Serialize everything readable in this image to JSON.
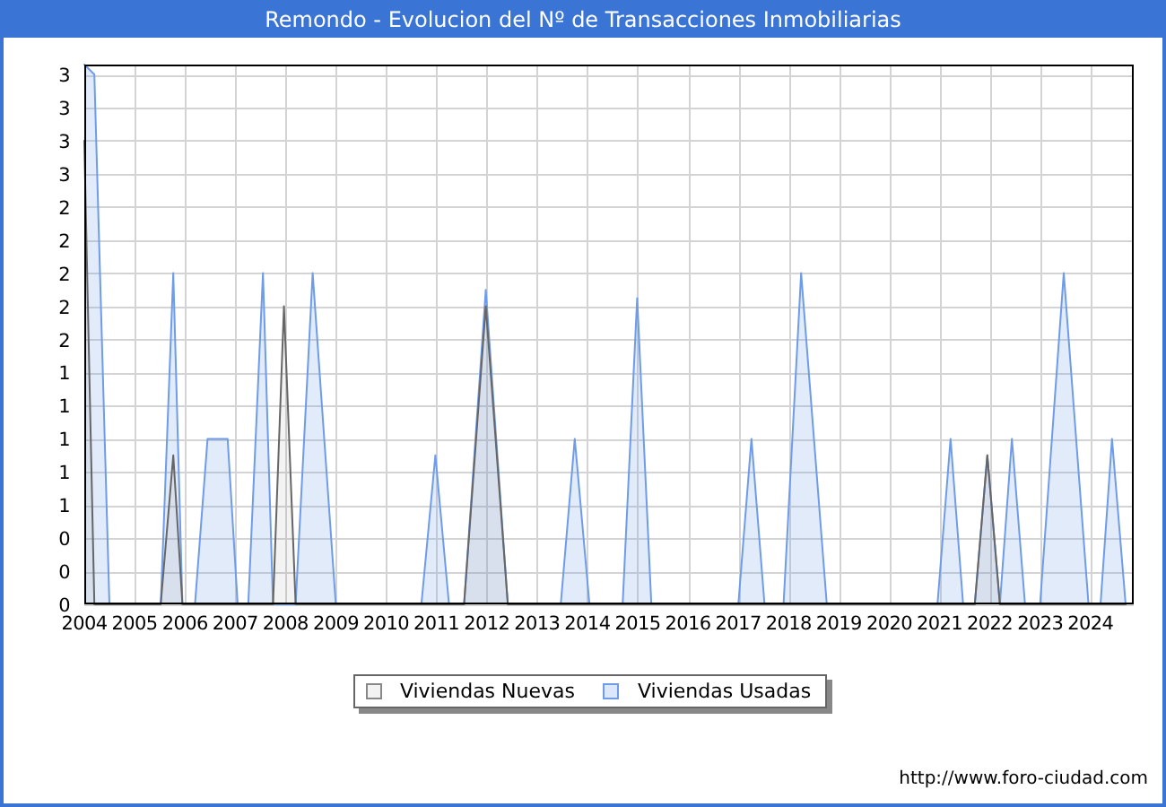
{
  "chart_data": {
    "type": "area",
    "title": "Remondo - Evolucion del Nº de Transacciones Inmobiliarias",
    "xlim": [
      2004,
      2024.86
    ],
    "ylim": [
      0,
      3.26
    ],
    "grid": true,
    "x": [
      2004,
      2004.2,
      2004.5,
      2005.52,
      2005.77,
      2005.95,
      2006.2,
      2006.45,
      2006.85,
      2007.05,
      2007.26,
      2007.55,
      2007.75,
      2007.97,
      2008.2,
      2008.54,
      2009.0,
      2010.7,
      2010.98,
      2011.25,
      2011.55,
      2011.98,
      2012.42,
      2013.47,
      2013.75,
      2014.04,
      2014.7,
      2014.99,
      2015.27,
      2017.0,
      2017.26,
      2017.52,
      2017.9,
      2018.25,
      2018.76,
      2020.96,
      2021.22,
      2021.47,
      2021.7,
      2021.95,
      2022.2,
      2022.44,
      2022.7,
      2023.0,
      2023.47,
      2023.96,
      2024.2,
      2024.43,
      2024.7
    ],
    "series": [
      {
        "name": "Viviendas Nuevas",
        "color": "#666666",
        "values": [
          2.8,
          0,
          0,
          0,
          0.9,
          0,
          0,
          0,
          0,
          0,
          0,
          0,
          0,
          1.8,
          0,
          0,
          0,
          0,
          0,
          0,
          0,
          1.8,
          0,
          0,
          0,
          0,
          0,
          0,
          0,
          0,
          0,
          0,
          0,
          0,
          0,
          0,
          0,
          0,
          0,
          0.9,
          0,
          0,
          0,
          0,
          0,
          0,
          0,
          0,
          0
        ]
      },
      {
        "name": "Viviendas Usadas",
        "color": "#6f9ce8",
        "values": [
          3.26,
          3.2,
          0,
          0,
          2,
          0,
          0,
          1,
          1,
          0,
          0,
          2,
          0,
          0,
          0,
          2,
          0,
          0,
          0.9,
          0,
          0,
          1.9,
          0,
          0,
          1,
          0,
          0,
          1.85,
          0,
          0,
          1,
          0,
          0,
          2,
          0,
          0,
          1,
          0,
          0,
          0.9,
          0,
          1,
          0,
          0,
          2,
          0,
          0,
          1,
          0
        ]
      }
    ],
    "xticks": [
      2004,
      2005,
      2006,
      2007,
      2008,
      2009,
      2010,
      2011,
      2012,
      2013,
      2014,
      2015,
      2016,
      2017,
      2018,
      2019,
      2020,
      2021,
      2022,
      2023,
      2024
    ],
    "yticks": [
      {
        "value": 0,
        "label": "0"
      },
      {
        "value": 0.2,
        "label": "0"
      },
      {
        "value": 0.4,
        "label": "0"
      },
      {
        "value": 0.6,
        "label": "1"
      },
      {
        "value": 0.8,
        "label": "1"
      },
      {
        "value": 1,
        "label": "1"
      },
      {
        "value": 1.2,
        "label": "1"
      },
      {
        "value": 1.4,
        "label": "1"
      },
      {
        "value": 1.6,
        "label": "2"
      },
      {
        "value": 1.8,
        "label": "2"
      },
      {
        "value": 2,
        "label": "2"
      },
      {
        "value": 2.2,
        "label": "2"
      },
      {
        "value": 2.4,
        "label": "2"
      },
      {
        "value": 2.6,
        "label": "3"
      },
      {
        "value": 2.8,
        "label": "3"
      },
      {
        "value": 3,
        "label": "3"
      },
      {
        "value": 3.2,
        "label": "3"
      }
    ]
  },
  "footer": {
    "url": "http://www.foro-ciudad.com"
  }
}
